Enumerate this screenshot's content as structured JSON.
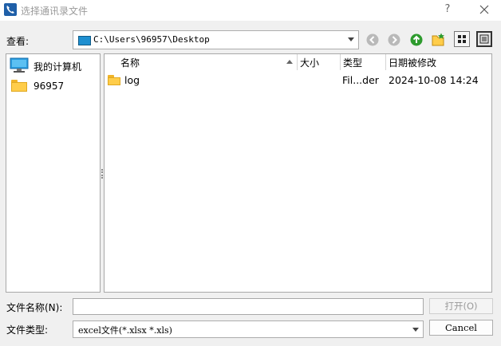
{
  "window": {
    "title": "选择通讯录文件",
    "help_glyph": "?",
    "close_icon": "close-icon"
  },
  "lookin": {
    "label": "查看:",
    "path": "C:\\Users\\96957\\Desktop"
  },
  "toolbar": {
    "icons": [
      "back-icon",
      "forward-icon",
      "up-icon",
      "new-folder-icon",
      "list-view-icon",
      "detail-view-icon"
    ],
    "active_view": "detail-view"
  },
  "sidebar": {
    "items": [
      {
        "label": "我的计算机",
        "icon": "computer-icon"
      },
      {
        "label": "96957",
        "icon": "folder-icon"
      }
    ]
  },
  "files": {
    "columns": [
      "名称",
      "大小",
      "类型",
      "日期被修改"
    ],
    "sort_column": "名称",
    "rows": [
      {
        "name": "log",
        "size": "",
        "type": "Fil...der",
        "modified": "2024-10-08 14:24",
        "icon": "folder-icon"
      }
    ]
  },
  "filename": {
    "label": "文件名称(N):",
    "value": ""
  },
  "filetype": {
    "label": "文件类型:",
    "selected": "excel文件(*.xlsx *.xls)"
  },
  "buttons": {
    "open": "打开(O)",
    "cancel": "Cancel"
  },
  "colors": {
    "accent": "#1e8fd0",
    "folder": "#ffcd4a",
    "up_arrow": "#2e9b2e"
  }
}
